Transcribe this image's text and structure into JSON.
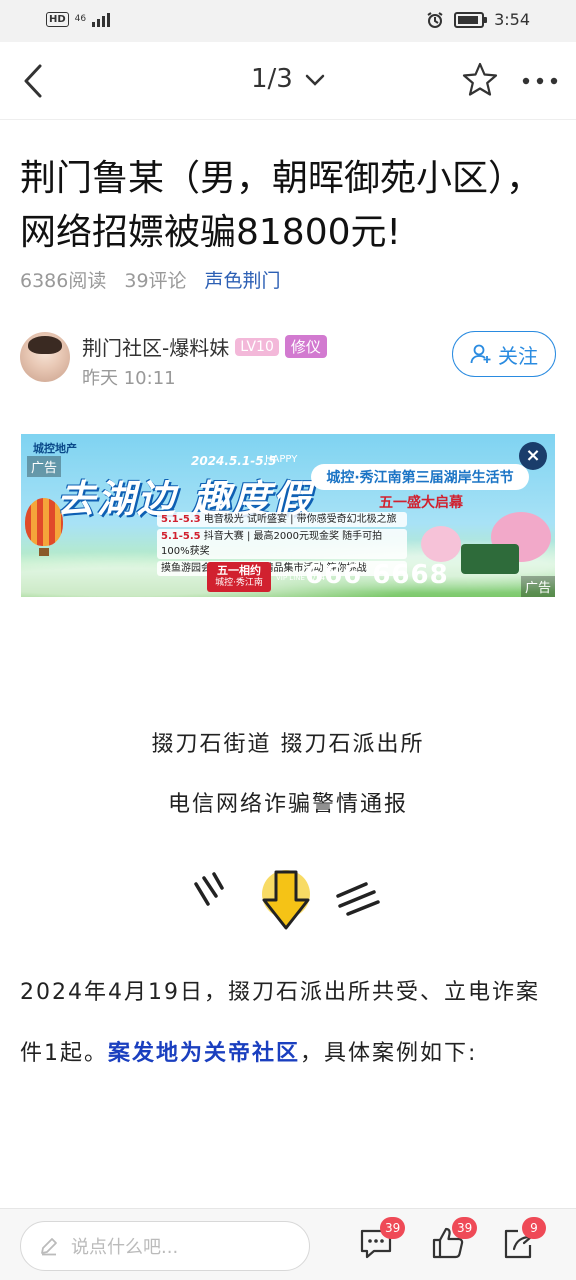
{
  "status_bar": {
    "network": "HD",
    "network_gen": "46",
    "time": "3:54"
  },
  "nav": {
    "pager": "1/3"
  },
  "article": {
    "title": "荆门鲁某（男，朝晖御苑小区），网络招嫖被骗81800元!",
    "reads": "6386阅读",
    "comments": "39评论",
    "tag": "声色荆门"
  },
  "author": {
    "name": "荆门社区-爆料妹",
    "level": "LV10",
    "badge": "修仪",
    "time": "昨天 10:11",
    "follow_label": "关注"
  },
  "ad": {
    "brand": "城控地产",
    "ad_label": "广告",
    "headline": "去湖边 趣度假",
    "date": "2024.5.1-5.5",
    "happy": "HAPPY",
    "festival": "城控·秀江南第三届湖岸生活节",
    "opening": "五一盛大启幕",
    "line1_date": "5.1-5.3",
    "line1": "电音极光  试听盛宴 | 带你感受奇幻北极之旅",
    "line2_date": "5.1-5.5",
    "line2": "抖音大赛 | 最高2000元现金奖  随手可拍  100%获奖",
    "line3": "摸鱼游园会 | 12大主题精品集市活动  等你挑战",
    "yue_title": "五一相约",
    "yue_sub": "城控·秀江南",
    "vip": "VIP LINE 0724",
    "phone": "666 6668",
    "close": "×"
  },
  "content": {
    "heading1": "掇刀石街道 掇刀石派出所",
    "heading2": "电信网络诈骗警情通报",
    "para_part1": "2024年4月19日，掇刀石派出所共受、立电诈案件1起。",
    "para_highlight": "案发地为关帝社区",
    "para_part2": "，具体案例如下:"
  },
  "bottom": {
    "comment_placeholder": "说点什么吧...",
    "comment_count": "39",
    "like_count": "39",
    "share_count": "9"
  }
}
